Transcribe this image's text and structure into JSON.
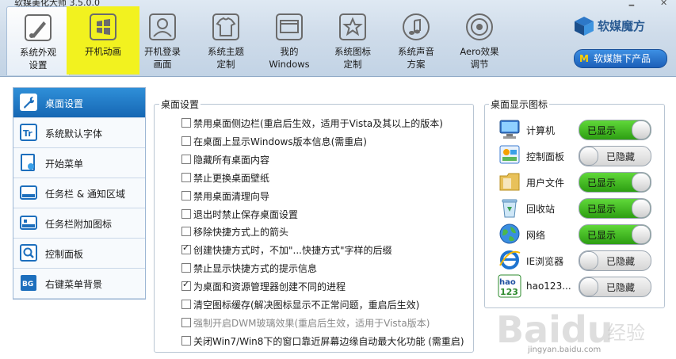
{
  "window": {
    "title": "软媒美化大师 3.5.0.0",
    "controls": [
      "🗕",
      "✕"
    ]
  },
  "toolbar": {
    "items": [
      {
        "label": "系统外观\n设置",
        "icon": "brush-icon"
      },
      {
        "label": "开机动画",
        "icon": "windows-logo-icon"
      },
      {
        "label": "开机登录\n画面",
        "icon": "user-login-icon"
      },
      {
        "label": "系统主题\n定制",
        "icon": "tshirt-icon"
      },
      {
        "label": "我的\nWindows",
        "icon": "window-icon"
      },
      {
        "label": "系统图标\n定制",
        "icon": "star-icon"
      },
      {
        "label": "系统声音\n方案",
        "icon": "music-note-icon"
      },
      {
        "label": "Aero效果\n调节",
        "icon": "aero-circle-icon"
      }
    ],
    "selected_index": 1,
    "highlight_color": "#f2f21f"
  },
  "brand": {
    "name": "软媒魔方",
    "products_button": "软媒旗下产品"
  },
  "nav": {
    "items": [
      {
        "label": "桌面设置",
        "icon": "wrench-icon"
      },
      {
        "label": "系统默认字体",
        "icon": "font-icon"
      },
      {
        "label": "开始菜单",
        "icon": "start-menu-icon"
      },
      {
        "label": "任务栏 & 通知区域",
        "icon": "taskbar-icon"
      },
      {
        "label": "任务栏附加图标",
        "icon": "taskbar-pin-icon"
      },
      {
        "label": "控制面板",
        "icon": "magnifier-icon"
      },
      {
        "label": "右键菜单背景",
        "icon": "bg-icon"
      }
    ],
    "active_index": 0
  },
  "desktop_settings": {
    "title": "桌面设置",
    "options": [
      {
        "label": "禁用桌面侧边栏(重启后生效，适用于Vista及其以上的版本)",
        "checked": false,
        "disabled": false
      },
      {
        "label": "在桌面上显示Windows版本信息(需重启)",
        "checked": false,
        "disabled": false
      },
      {
        "label": "隐藏所有桌面内容",
        "checked": false,
        "disabled": false
      },
      {
        "label": "禁止更换桌面壁纸",
        "checked": false,
        "disabled": false
      },
      {
        "label": "禁用桌面清理向导",
        "checked": false,
        "disabled": false
      },
      {
        "label": "退出时禁止保存桌面设置",
        "checked": false,
        "disabled": false
      },
      {
        "label": "移除快捷方式上的箭头",
        "checked": false,
        "disabled": false
      },
      {
        "label": "创建快捷方式时，不加\"...快捷方式\"字样的后缀",
        "checked": true,
        "disabled": false
      },
      {
        "label": "禁止显示快捷方式的提示信息",
        "checked": false,
        "disabled": false
      },
      {
        "label": "为桌面和资源管理器创建不同的进程",
        "checked": true,
        "disabled": false
      },
      {
        "label": "清空图标缓存(解决图标显示不正常问题，重启后生效)",
        "checked": false,
        "disabled": false
      },
      {
        "label": "强制开启DWM玻璃效果(重启后生效，适用于Vista版本)",
        "checked": false,
        "disabled": true
      },
      {
        "label": "关闭Win7/Win8下的窗口靠近屏幕边缘自动最大化功能 (需重启)",
        "checked": false,
        "disabled": false
      }
    ]
  },
  "desktop_icons": {
    "title": "桌面显示图标",
    "shown_label": "已显示",
    "hidden_label": "已隐藏",
    "items": [
      {
        "name": "计算机",
        "shown": true,
        "icon": "computer-icon"
      },
      {
        "name": "控制面板",
        "shown": false,
        "icon": "control-panel-icon"
      },
      {
        "name": "用户文件",
        "shown": true,
        "icon": "folder-icon"
      },
      {
        "name": "回收站",
        "shown": true,
        "icon": "recycle-bin-icon"
      },
      {
        "name": "网络",
        "shown": true,
        "icon": "network-globe-icon"
      },
      {
        "name": "IE浏览器",
        "shown": false,
        "icon": "ie-icon"
      },
      {
        "name": "hao123...",
        "shown": false,
        "icon": "hao123-icon"
      }
    ]
  },
  "watermark": {
    "text": "Baidu经验",
    "sub": "jingyan.baidu.com"
  },
  "colors": {
    "accent": "#1d6fbd",
    "toggle_on": "#3bb51c",
    "toggle_off": "#dcdcdc"
  }
}
